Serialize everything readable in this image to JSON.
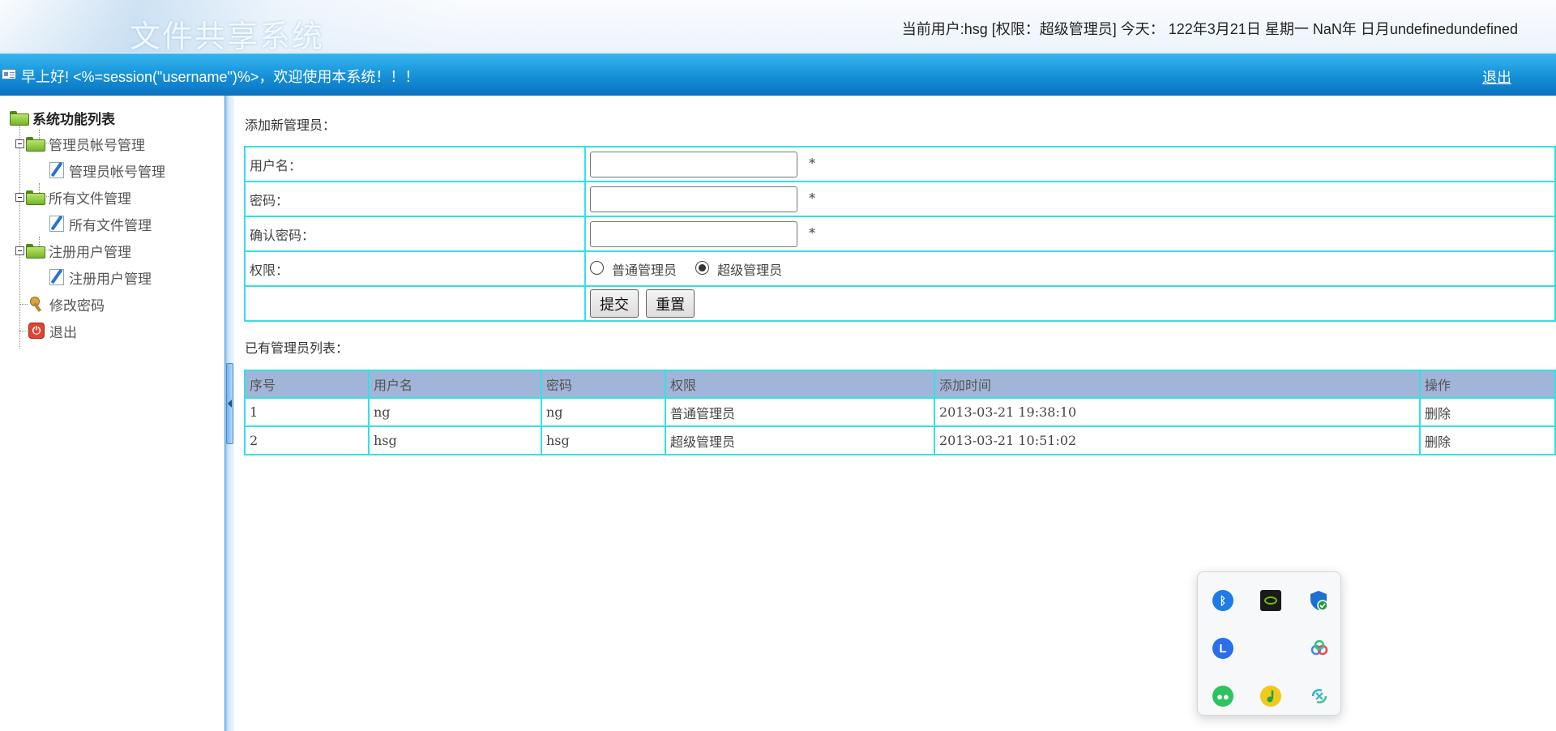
{
  "header": {
    "system_title": "文件共享系统",
    "user_info": "当前用户:hsg [权限：超级管理员] 今天： 122年3月21日 星期一 NaN年 日月undefinedundefined"
  },
  "bluebar": {
    "greeting": "早上好! <%=session(\"username\")%>，欢迎使用本系统！！！",
    "logout_label": "退出"
  },
  "sidebar": {
    "root_label": "系统功能列表",
    "groups": [
      {
        "label": "管理员帐号管理",
        "child": "管理员帐号管理"
      },
      {
        "label": "所有文件管理",
        "child": "所有文件管理"
      },
      {
        "label": "注册用户管理",
        "child": "注册用户管理"
      }
    ],
    "change_password": "修改密码",
    "exit": "退出"
  },
  "form": {
    "title": "添加新管理员：",
    "username_label": "用户名：",
    "password_label": "密码：",
    "confirm_label": "确认密码：",
    "permission_label": "权限：",
    "required_mark": "*",
    "username_value": "",
    "password_value": "",
    "confirm_value": "",
    "option_normal": "普通管理员",
    "option_super": "超级管理员",
    "selected_option": "超级管理员",
    "submit_label": "提交",
    "reset_label": "重置"
  },
  "admin_list": {
    "title": "已有管理员列表：",
    "columns": [
      "序号",
      "用户名",
      "密码",
      "权限",
      "添加时间",
      "操作"
    ],
    "rows": [
      {
        "index": "1",
        "username": "ng",
        "password": "ng",
        "permission": "普通管理员",
        "added": "2013-03-21 19:38:10",
        "action": "删除"
      },
      {
        "index": "2",
        "username": "hsg",
        "password": "hsg",
        "permission": "超级管理员",
        "added": "2013-03-21 10:51:02",
        "action": "删除"
      }
    ]
  },
  "tray": {
    "icons": [
      "bluetooth-icon",
      "nvidia-icon",
      "windows-security-icon",
      "lark-icon",
      "cloud-drive-icon",
      "wechat-icon",
      "qq-music-icon",
      "sync-icon"
    ]
  },
  "colors": {
    "bluebar": "#1590d8",
    "table_border": "#33e0e8",
    "table_header": "#a0b5d8"
  }
}
